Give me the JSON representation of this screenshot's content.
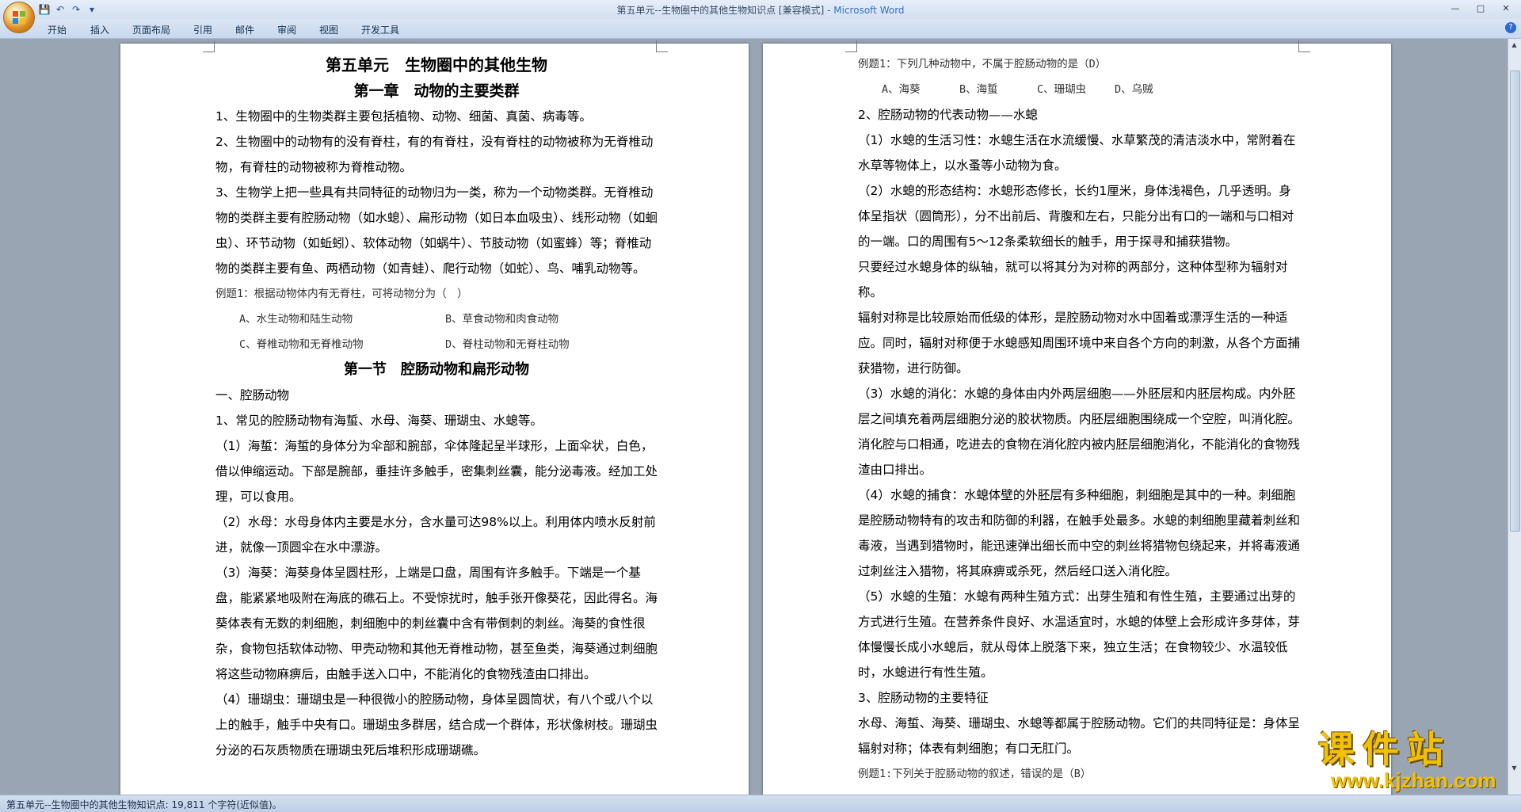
{
  "window": {
    "title": "第五单元--生物圈中的其他生物知识点 [兼容模式] - ",
    "app_name": "Microsoft Word",
    "accent": "#3a6fc0"
  },
  "quick_access": {
    "save_icon": "save-icon",
    "undo_icon": "undo-icon",
    "redo_icon": "redo-icon",
    "customize_icon": "dropdown-icon"
  },
  "ribbon": {
    "tabs": [
      "开始",
      "插入",
      "页面布局",
      "引用",
      "邮件",
      "审阅",
      "视图",
      "开发工具"
    ]
  },
  "page1": {
    "title1": "第五单元　生物圈中的其他生物",
    "title2": "第一章　动物的主要类群",
    "p1": "1、生物圈中的生物类群主要包括植物、动物、细菌、真菌、病毒等。",
    "p2": "2、生物圈中的动物有的没有脊柱，有的有脊柱，没有脊柱的动物被称为无脊椎动物，有脊柱的动物被称为脊椎动物。",
    "p3": "3、生物学上把一些具有共同特征的动物归为一类，称为一个动物类群。无脊椎动物的类群主要有腔肠动物（如水螅）、扁形动物（如日本血吸虫）、线形动物（如蛔虫）、环节动物（如蚯蚓）、软体动物（如蜗牛）、节肢动物（如蜜蜂）等；脊椎动物的类群主要有鱼、两栖动物（如青蛙）、爬行动物（如蛇）、鸟、哺乳动物等。",
    "ex1": "例题1：根据动物体内有无脊柱，可将动物分为（　）",
    "ex1_opts": [
      "A、水生动物和陆生动物",
      "B、草食动物和肉食动物",
      "C、脊椎动物和无脊椎动物",
      "D、脊柱动物和无脊柱动物"
    ],
    "section": "第一节　腔肠动物和扁形动物",
    "p4": "一、腔肠动物",
    "p5": "1、常见的腔肠动物有海蜇、水母、海葵、珊瑚虫、水螅等。",
    "p6": "（1）海蜇：海蜇的身体分为伞部和腕部，伞体隆起呈半球形，上面伞状，白色，借以伸缩运动。下部是腕部，垂挂许多触手，密集刺丝囊，能分泌毒液。经加工处理，可以食用。",
    "p7": "（2）水母：水母身体内主要是水分，含水量可达98%以上。利用体内喷水反射前进，就像一顶圆伞在水中漂游。",
    "p8": "（3）海葵：海葵身体呈圆柱形，上端是口盘，周围有许多触手。下端是一个基盘，能紧紧地吸附在海底的礁石上。不受惊扰时，触手张开像葵花，因此得名。海葵体表有无数的刺细胞，刺细胞中的刺丝囊中含有带倒刺的刺丝。海葵的食性很杂，食物包括软体动物、甲壳动物和其他无脊椎动物，甚至鱼类，海葵通过刺细胞将这些动物麻痹后，由触手送入口中，不能消化的食物残渣由口排出。",
    "p9": "（4）珊瑚虫：珊瑚虫是一种很微小的腔肠动物，身体呈圆筒状，有八个或八个以上的触手，触手中央有口。珊瑚虫多群居，结合成一个群体，形状像树枝。珊瑚虫分泌的石灰质物质在珊瑚虫死后堆积形成珊瑚礁。"
  },
  "page2": {
    "ex2": "例题1：下列几种动物中，不属于腔肠动物的是（D）",
    "ex2_opts": [
      "A、海葵",
      "B、海蜇",
      "C、珊瑚虫",
      "D、乌贼"
    ],
    "q1": "2、腔肠动物的代表动物——水螅",
    "q2": "（1）水螅的生活习性：水螅生活在水流缓慢、水草繁茂的清洁淡水中，常附着在水草等物体上，以水蚤等小动物为食。",
    "q3": "（2）水螅的形态结构：水螅形态修长，长约1厘米，身体浅褐色，几乎透明。身体呈指状（圆筒形），分不出前后、背腹和左右，只能分出有口的一端和与口相对的一端。口的周围有5～12条柔软细长的触手，用于探寻和捕获猎物。",
    "q4": "只要经过水螅身体的纵轴，就可以将其分为对称的两部分，这种体型称为辐射对称。",
    "q5": "辐射对称是比较原始而低级的体形，是腔肠动物对水中固着或漂浮生活的一种适应。同时，辐射对称便于水螅感知周围环境中来自各个方向的刺激，从各个方面捕获猎物，进行防御。",
    "q6": "（3）水螅的消化：水螅的身体由内外两层细胞——外胚层和内胚层构成。内外胚层之间填充着两层细胞分泌的胶状物质。内胚层细胞围绕成一个空腔，叫消化腔。消化腔与口相通，吃进去的食物在消化腔内被内胚层细胞消化，不能消化的食物残渣由口排出。",
    "q7": "（4）水螅的捕食：水螅体壁的外胚层有多种细胞，刺细胞是其中的一种。刺细胞是腔肠动物特有的攻击和防御的利器，在触手处最多。水螅的刺细胞里藏着刺丝和毒液，当遇到猎物时，能迅速弹出细长而中空的刺丝将猎物包绕起来，并将毒液通过刺丝注入猎物，将其麻痹或杀死，然后经口送入消化腔。",
    "q8": "（5）水螅的生殖：水螅有两种生殖方式：出芽生殖和有性生殖，主要通过出芽的方式进行生殖。在营养条件良好、水温适宜时，水螅的体壁上会形成许多芽体，芽体慢慢长成小水螅后，就从母体上脱落下来，独立生活；在食物较少、水温较低时，水螅进行有性生殖。",
    "q9": "3、腔肠动物的主要特征",
    "q10": "水母、海蜇、海葵、珊瑚虫、水螅等都属于腔肠动物。它们的共同特征是：身体呈辐射对称；体表有刺细胞；有口无肛门。",
    "ex3": "例题1:下列关于腔肠动物的叙述，错误的是（B）"
  },
  "status": {
    "text": "第五单元--生物圈中的其他生物知识点: 19,811 个字符(近似值)。"
  },
  "watermark": {
    "cn": "课件站",
    "url": "www.kjzhan.com"
  }
}
